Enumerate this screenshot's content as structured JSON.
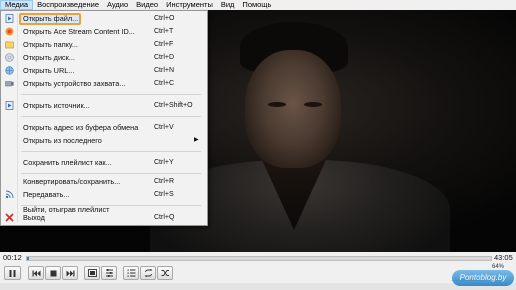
{
  "menubar": {
    "items": [
      "Медиа",
      "Воспроизведение",
      "Аудио",
      "Видео",
      "Инструменты",
      "Вид",
      "Помощь"
    ]
  },
  "media_menu": {
    "items": [
      {
        "label": "Открыть файл...",
        "shortcut": "Ctrl+O",
        "icon": "open-file-icon"
      },
      {
        "label": "Открыть Ace Stream Content ID...",
        "shortcut": "Ctrl+T",
        "icon": "ace-stream-icon"
      },
      {
        "label": "Открыть папку...",
        "shortcut": "Ctrl+F",
        "icon": "folder-icon"
      },
      {
        "label": "Открыть диск...",
        "shortcut": "Ctrl+D",
        "icon": "disc-icon"
      },
      {
        "label": "Открыть URL...",
        "shortcut": "Ctrl+N",
        "icon": "network-icon"
      },
      {
        "label": "Открыть устройство захвата...",
        "shortcut": "Ctrl+C",
        "icon": "capture-device-icon"
      },
      {
        "label": "Открыть источник...",
        "shortcut": "Ctrl+Shift+O",
        "icon": "open-source-icon"
      },
      {
        "label": "Открыть адрес из буфера обмена",
        "shortcut": "Ctrl+V",
        "icon": ""
      },
      {
        "label": "Открыть из последнего",
        "shortcut": "",
        "icon": "",
        "submenu": true
      },
      {
        "label": "Сохранить плейлист как...",
        "shortcut": "Ctrl+Y",
        "icon": ""
      },
      {
        "label": "Конвертировать/сохранить...",
        "shortcut": "Ctrl+R",
        "icon": ""
      },
      {
        "label": "Передавать...",
        "shortcut": "Ctrl+S",
        "icon": "stream-icon"
      },
      {
        "label": "Выйти, отыграв плейлист",
        "shortcut": "",
        "icon": ""
      },
      {
        "label": "Выход",
        "shortcut": "Ctrl+Q",
        "icon": "exit-icon"
      }
    ]
  },
  "timebar": {
    "elapsed": "00:12",
    "total": "43:05",
    "progress": 0.005
  },
  "volume": {
    "percent_label": "64%",
    "level": 0.64
  },
  "watermark": "Pontoblog.by",
  "colors": {
    "highlight_border": "#e8a33c",
    "seek_fill": "#2f7fd8",
    "volume_fill": "#76c043"
  }
}
